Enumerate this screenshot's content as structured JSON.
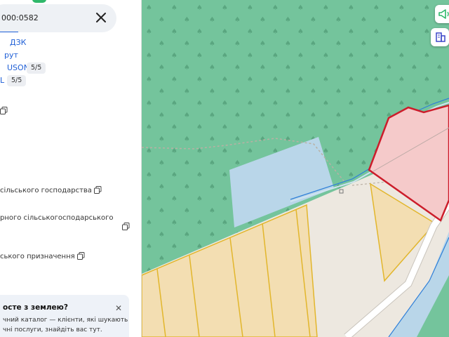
{
  "search": {
    "value": "000:0582"
  },
  "panel": {
    "links": [
      {
        "text": "ДЗК",
        "id": "dzk"
      },
      {
        "text": "рут",
        "id": "route"
      },
      {
        "text": "USON",
        "id": "geojson",
        "badge": "5/5"
      },
      {
        "text": "L",
        "id": "kml",
        "badge": "5/5"
      }
    ],
    "fields": [
      {
        "text": "сільського господарства"
      },
      {
        "text": "рного сільськогосподарського"
      },
      {
        "text": "ського призначення"
      }
    ]
  },
  "card": {
    "title": "осте з землею?",
    "line1": "чний каталог — клієнти, які шукають",
    "line2": "чні послуги, знайдіть вас тут."
  },
  "map": {
    "colors": {
      "forest": "#74c49c",
      "water": "#b9d6e9",
      "meadow": "#ede8e0",
      "parcel_fill": "#f3deb2",
      "parcel_border": "#e2b62c",
      "selected_fill": "#f5caca",
      "selected_border": "#cc1d2b",
      "road": "#ffffff",
      "stream": "#2f7fd8"
    },
    "icons": [
      "megaphone-icon",
      "buildings-icon"
    ]
  }
}
